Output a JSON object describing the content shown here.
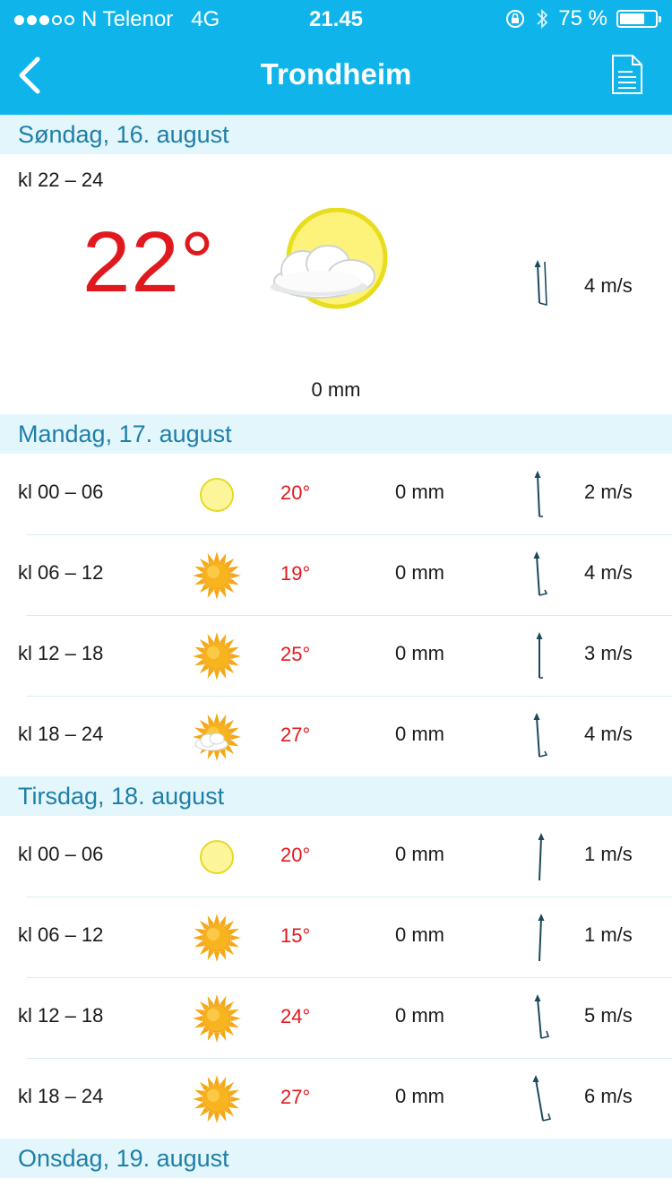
{
  "status_bar": {
    "carrier": "N Telenor",
    "network": "4G",
    "time": "21.45",
    "battery_text": "75 %",
    "battery_level": 0.75
  },
  "nav": {
    "title": "Trondheim",
    "back_icon": "chevron-left-icon",
    "document_icon": "document-icon"
  },
  "current": {
    "day": "Søndag, 16. august",
    "period": "kl 22 – 24",
    "temperature": "22°",
    "icon": "partly-cloudy-sun-icon",
    "precipitation": "0 mm",
    "wind": "4 m/s",
    "wind_direction": "slightly left of north"
  },
  "days": [
    {
      "label": "Mandag, 17. august",
      "rows": [
        {
          "period": "kl 00 – 06",
          "icon": "clear-sky-icon",
          "temperature": "20°",
          "precipitation": "0 mm",
          "wind": "2 m/s"
        },
        {
          "period": "kl 06 – 12",
          "icon": "sun-icon",
          "temperature": "19°",
          "precipitation": "0 mm",
          "wind": "4 m/s"
        },
        {
          "period": "kl 12 – 18",
          "icon": "sun-icon",
          "temperature": "25°",
          "precipitation": "0 mm",
          "wind": "3 m/s"
        },
        {
          "period": "kl 18 – 24",
          "icon": "sun-cloud-icon",
          "temperature": "27°",
          "precipitation": "0 mm",
          "wind": "4 m/s"
        }
      ]
    },
    {
      "label": "Tirsdag, 18. august",
      "rows": [
        {
          "period": "kl 00 – 06",
          "icon": "clear-sky-icon",
          "temperature": "20°",
          "precipitation": "0 mm",
          "wind": "1 m/s"
        },
        {
          "period": "kl 06 – 12",
          "icon": "sun-icon",
          "temperature": "15°",
          "precipitation": "0 mm",
          "wind": "1 m/s"
        },
        {
          "period": "kl 12 – 18",
          "icon": "sun-icon",
          "temperature": "24°",
          "precipitation": "0 mm",
          "wind": "5 m/s"
        },
        {
          "period": "kl 18 – 24",
          "icon": "sun-icon",
          "temperature": "27°",
          "precipitation": "0 mm",
          "wind": "6 m/s"
        }
      ]
    }
  ],
  "next_day": "Onsdag, 19. august",
  "colors": {
    "bar": "#0fb5ea",
    "header_bg": "#e3f6fb",
    "header_text": "#1f7fa8",
    "temperature": "#e0191e",
    "arrow": "#1b4a5c"
  }
}
